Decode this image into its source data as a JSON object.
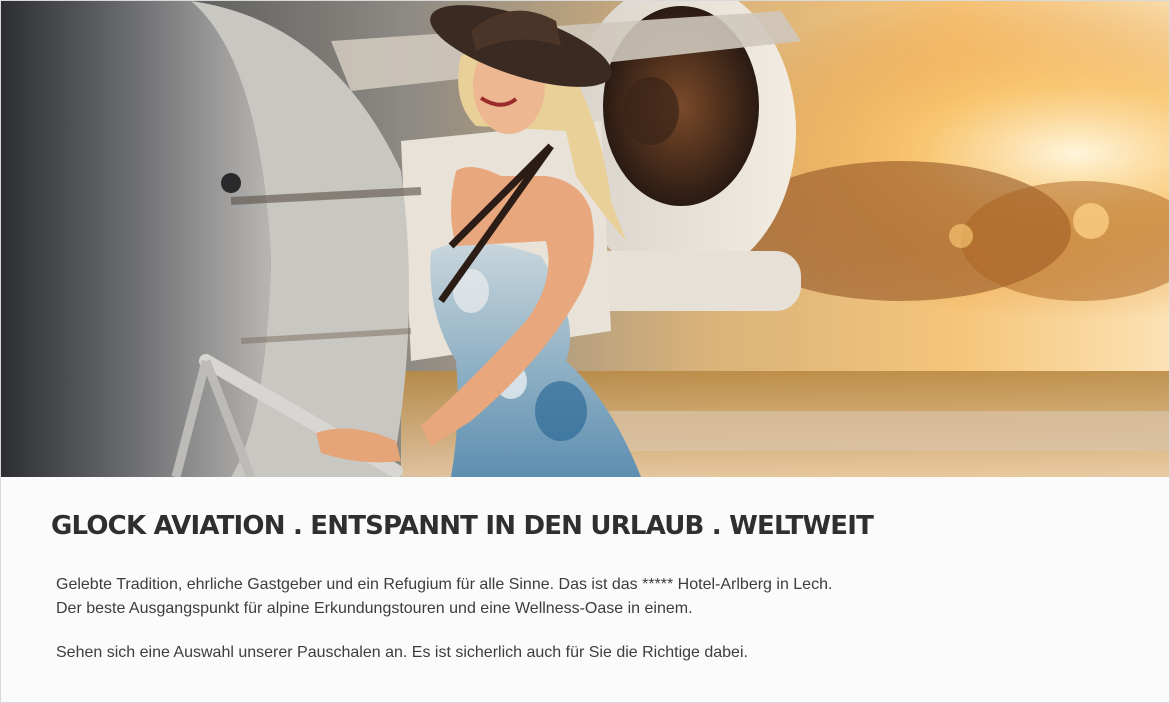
{
  "hero": {
    "alt": "Frau mit Hut an der Treppe eines Privatjets bei Sonnenuntergang"
  },
  "content": {
    "headline": "GLOCK AVIATION . ENTSPANNT IN DEN URLAUB . WELTWEIT",
    "paragraph_1_line_1": "Gelebte Tradition, ehrliche Gastgeber und ein Refugium für alle Sinne. Das ist das ***** Hotel-Arlberg in Lech.",
    "paragraph_1_line_2": "Der beste Ausgangspunkt für alpine Erkundungstouren und eine Wellness-Oase in einem.",
    "paragraph_2": "Sehen sich eine Auswahl unserer Pauschalen an. Es ist sicherlich auch für Sie die Richtige dabei."
  },
  "colors": {
    "headline": "#2f2f2f",
    "body_text": "#3d3d3d",
    "background": "#fcfbfb",
    "sunset": "#f2b45a"
  }
}
